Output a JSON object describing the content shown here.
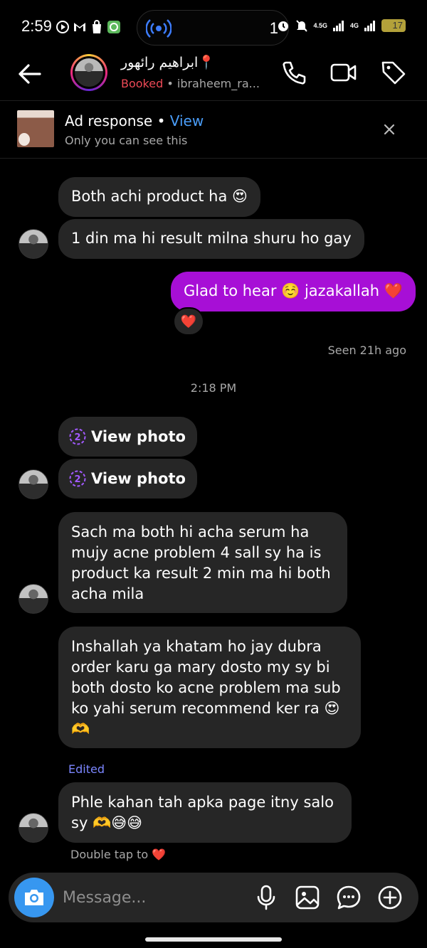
{
  "status_bar": {
    "time": "2:59",
    "pill_count": "1",
    "net1": "4.5G",
    "net2": "4G",
    "battery": "17"
  },
  "header": {
    "name": "ابراهیم رائھور📍",
    "booked": "Booked",
    "username": "• ibraheem_ra..."
  },
  "ad": {
    "title": "Ad response",
    "separator": "•",
    "view": "View",
    "subtitle": "Only you can see this"
  },
  "messages": {
    "m1": "Both achi product ha 😍",
    "m2": "1 din ma hi result milna shuru ho gay",
    "m3": "Glad to hear ☺️ jazakallah ❤️",
    "reaction": "❤️",
    "seen": "Seen 21h ago",
    "time": "2:18 PM",
    "photo1": "View photo",
    "photo2": "View photo",
    "photo_badge": "2",
    "m4_lines": [
      "Sach ma both hi acha serum ha",
      "mujy acne problem 4 sall sy ha is",
      "product ka result 2 min ma hi both",
      "acha mila"
    ],
    "m5_lines": [
      "Inshallah ya khatam ho jay dubra",
      "order karu ga mary dosto my sy bi",
      "both dosto ko acne problem ma sub",
      "ko yahi serum recommend ker ra 😍",
      "🫶"
    ],
    "edited": "Edited",
    "m6_lines": [
      "Phle kahan tah apka page itny salo",
      "sy 🫶😅😅"
    ],
    "double_tap": "Double tap to ❤️"
  },
  "composer": {
    "placeholder": "Message..."
  },
  "colors": {
    "accent_blue": "#3797f0",
    "outgoing_bubble": "#a70fd6",
    "incoming_bubble": "#262626",
    "booked": "#ed4956"
  }
}
